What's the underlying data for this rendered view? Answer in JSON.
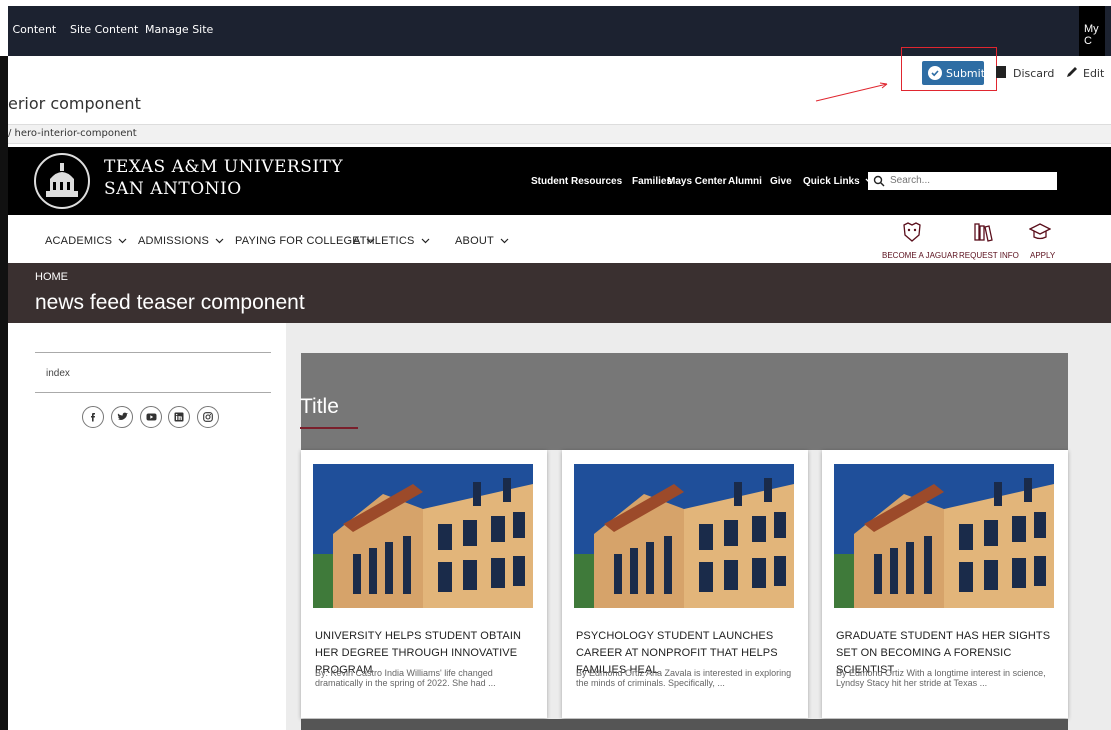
{
  "cms_bar": {
    "items": [
      "d Content",
      "Site Content",
      "Manage Site"
    ],
    "right_label": "My C"
  },
  "toolbar": {
    "page_title": "erior component",
    "submit_label": "Submit",
    "discard_label": "Discard",
    "edit_label": "Edit",
    "path": "/ hero-interior-component"
  },
  "site": {
    "name_line1": "TEXAS A&M UNIVERSITY",
    "name_line2": "SAN ANTONIO",
    "top_links": [
      "Student Resources",
      "Families",
      "Mays Center",
      "Alumni",
      "Give",
      "Quick Links"
    ],
    "search_placeholder": "Search..."
  },
  "nav": {
    "items": [
      "ACADEMICS",
      "ADMISSIONS",
      "PAYING FOR COLLEGE",
      "ATHLETICS",
      "ABOUT"
    ],
    "cta": [
      "BECOME A JAGUAR",
      "REQUEST INFO",
      "APPLY"
    ]
  },
  "hero": {
    "breadcrumb": "HOME",
    "title": "news feed teaser component"
  },
  "sidebar": {
    "item": "index",
    "social_icons": [
      "facebook-icon",
      "twitter-icon",
      "youtube-icon",
      "linkedin-icon",
      "instagram-icon"
    ]
  },
  "section": {
    "title": "Title"
  },
  "cards": [
    {
      "headline": "UNIVERSITY HELPS STUDENT OBTAIN HER DEGREE THROUGH INNOVATIVE PROGRAM",
      "summary": "By: Kevin Castro India Williams' life changed dramatically in the spring of 2022. She had ..."
    },
    {
      "headline": "PSYCHOLOGY STUDENT LAUNCHES CAREER AT NONPROFIT THAT HELPS FAMILIES HEAL",
      "summary": "By Edmond Ortiz Ana Zavala is interested in exploring the minds of criminals. Specifically, ..."
    },
    {
      "headline": "GRADUATE STUDENT HAS HER SIGHTS SET ON BECOMING A FORENSIC SCIENTIST",
      "summary": "By Edmond Ortiz With a longtime interest in science, Lyndsy Stacy hit her stride at Texas ..."
    }
  ],
  "colors": {
    "cms_bar": "#1c2230",
    "submit": "#2e6da4",
    "maroon": "#5a0f1c",
    "hero": "#3a3030",
    "annotation": "#e0262f"
  }
}
